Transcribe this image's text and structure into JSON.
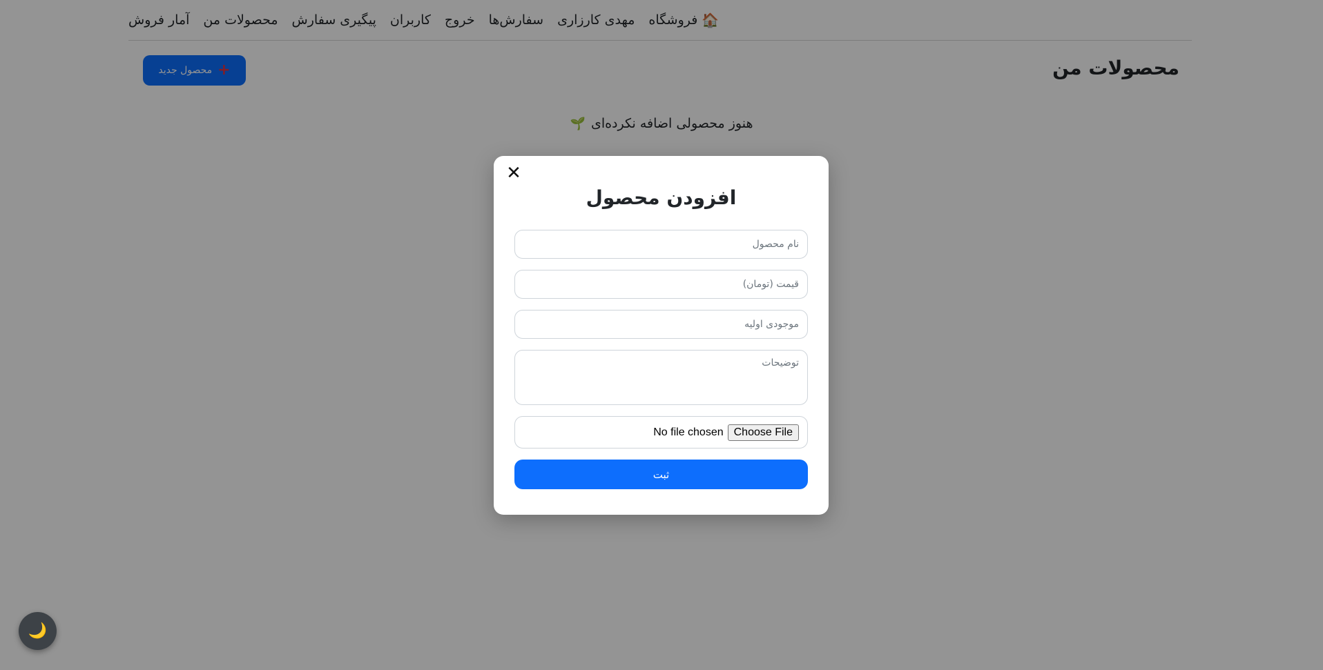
{
  "navbar": {
    "brand_icon": "house-icon",
    "brand_label": "فروشگاه",
    "items": [
      {
        "label": "مهدی کارزاری"
      },
      {
        "label": "سفارش‌ها"
      },
      {
        "label": "خروج"
      },
      {
        "label": "کاربران"
      },
      {
        "label": "پیگیری سفارش"
      },
      {
        "label": "محصولات من"
      },
      {
        "label": "آمار فروش"
      }
    ]
  },
  "main": {
    "title": "محصولات من",
    "new_button_label": "محصول جدید",
    "new_button_icon": "plus-icon",
    "empty_message": "هنوز محصولی اضافه نکرده‌ای",
    "empty_icon": "sprout-icon"
  },
  "modal": {
    "title": "افزودن محصول",
    "close_icon": "close-icon",
    "name_placeholder": "نام محصول",
    "price_placeholder": "قیمت (تومان)",
    "stock_placeholder": "موجودی اولیه",
    "description_placeholder": "توضیحات",
    "file_button_label": "Choose File",
    "file_status": "No file chosen",
    "submit_label": "ثبت"
  },
  "theme_toggle": {
    "icon": "moon-icon"
  },
  "colors": {
    "primary": "#0d6efd",
    "plus_accent": "#dc3545",
    "overlay": "rgba(0,0,0,0.42)"
  }
}
